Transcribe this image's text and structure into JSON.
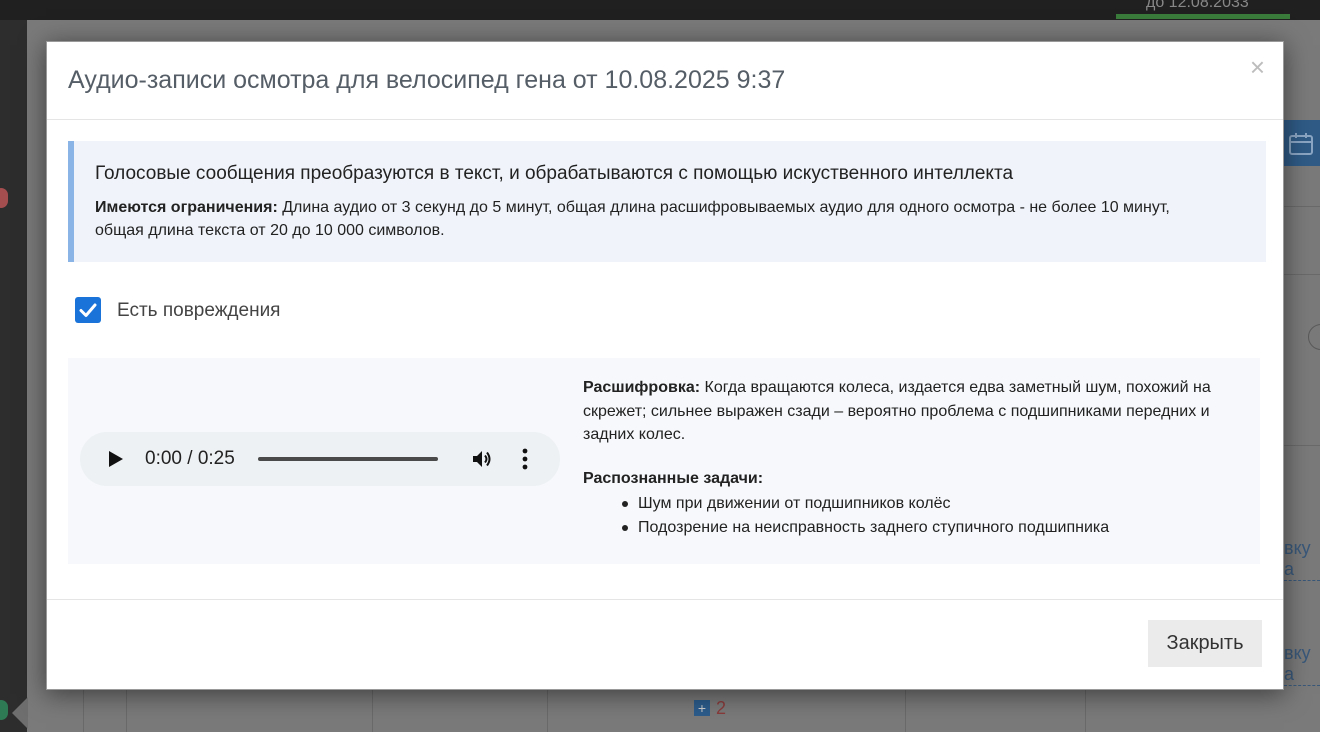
{
  "background": {
    "date_label": "до 12.08.2033",
    "link_fragment": "вку а",
    "count": "2"
  },
  "modal": {
    "title": "Аудио-записи осмотра для велосипед гена от 10.08.2025 9:37",
    "close_icon": "×",
    "info": {
      "heading": "Голосовые сообщения преобразуются в текст, и обрабатываются с помощью искуственного интеллекта",
      "restrictions_label": "Имеются ограничения:",
      "restrictions_text": " Длина аудио от 3 секунд до 5 минут, общая длина расшифровываемых аудио для одного осмотра - не более 10 минут, общая длина текста от 20 до 10 000 символов."
    },
    "damage_checkbox": {
      "label": "Есть повреждения",
      "checked": true
    },
    "record": {
      "player": {
        "time": "0:00 / 0:25"
      },
      "transcript_label": "Расшифровка:",
      "transcript_text": " Когда вращаются колеса, издается едва заметный шум, похожий на скрежет; сильнее выражен сзади – вероятно проблема с подшипниками передних и задних колес.",
      "tasks_title": "Распознанные задачи:",
      "tasks": [
        "Шум при движении от подшипников колёс",
        "Подозрение на неисправность заднего ступичного подшипника"
      ]
    },
    "footer": {
      "close_button": "Закрыть"
    }
  },
  "colors": {
    "accent": "#1a73d9",
    "info_border": "#8ab4e6",
    "info_bg": "#f0f4fa"
  }
}
